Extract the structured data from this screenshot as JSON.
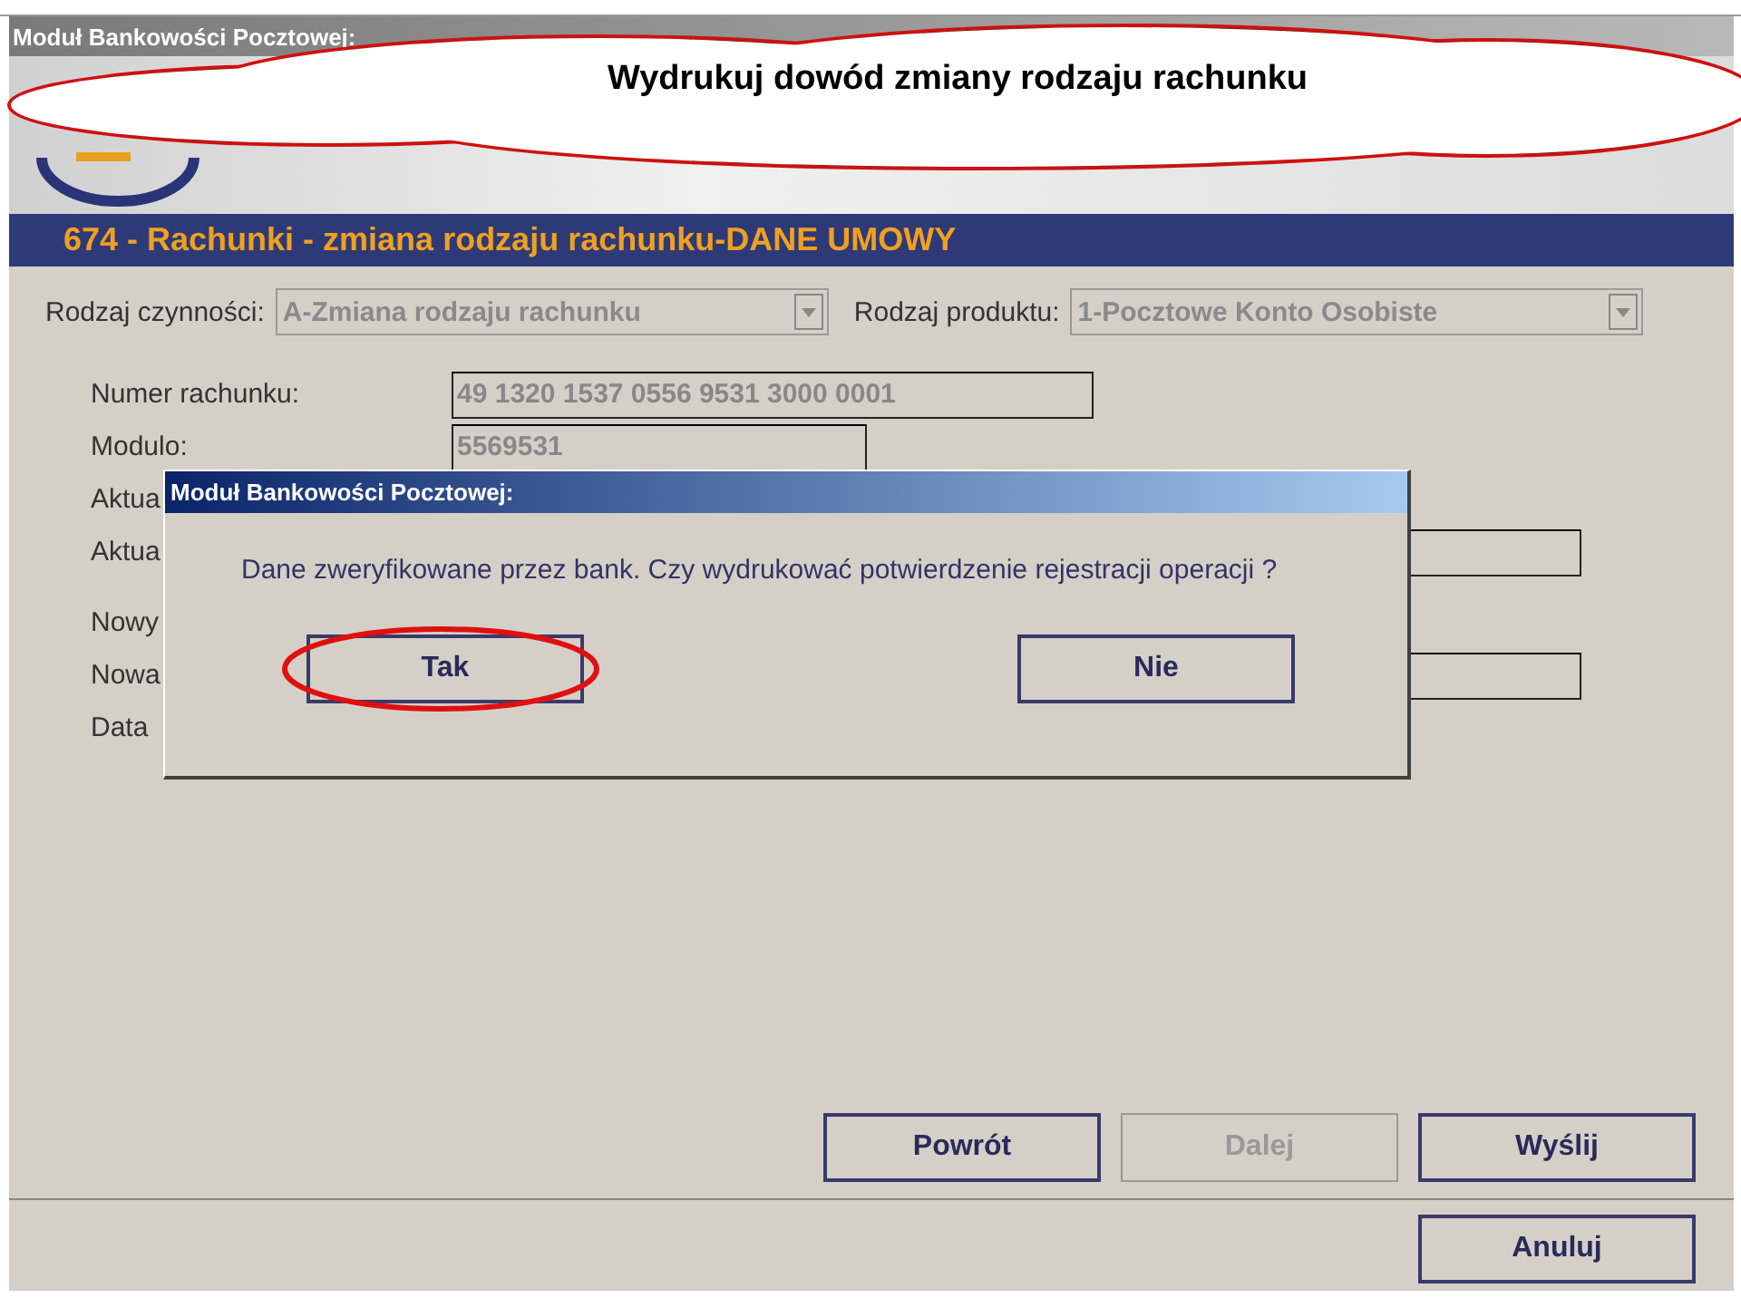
{
  "window": {
    "title": "Moduł Bankowości Pocztowej:"
  },
  "callout": {
    "text": "Wydrukuj dowód zmiany rodzaju rachunku"
  },
  "screen_title": "674 - Rachunki - zmiana rodzaju rachunku-DANE UMOWY",
  "selects": [
    {
      "label": "Rodzaj czynności:",
      "value": "A-Zmiana rodzaju rachunku",
      "disabled": true
    },
    {
      "label": "Rodzaj produktu:",
      "value": "1-Pocztowe Konto Osobiste",
      "disabled": true
    }
  ],
  "fields": [
    {
      "label": "Numer rachunku:",
      "value": "49 1320 1537 0556 9531 3000 0001",
      "kind": "wide"
    },
    {
      "label": "Modulo:",
      "value": "5569531",
      "kind": "narrow"
    },
    {
      "label": "Aktua",
      "kind": "none"
    },
    {
      "label": "Aktua",
      "kind": "long"
    },
    {
      "label": "Nowy",
      "kind": "none"
    },
    {
      "label": "Nowa",
      "kind": "long"
    },
    {
      "label": "Data",
      "kind": "none"
    }
  ],
  "dialog": {
    "title": "Moduł Bankowości Pocztowej:",
    "message": "Dane zweryfikowane przez bank. Czy wydrukować potwierdzenie rejestracji operacji ?",
    "buttons": [
      {
        "label": "Tak",
        "highlighted": true
      },
      {
        "label": "Nie",
        "highlighted": false
      }
    ]
  },
  "nav_buttons": [
    {
      "label": "Powrót",
      "disabled": false
    },
    {
      "label": "Dalej",
      "disabled": true
    },
    {
      "label": "Wyślij",
      "disabled": false
    }
  ],
  "cancel_button": {
    "label": "Anuluj"
  }
}
